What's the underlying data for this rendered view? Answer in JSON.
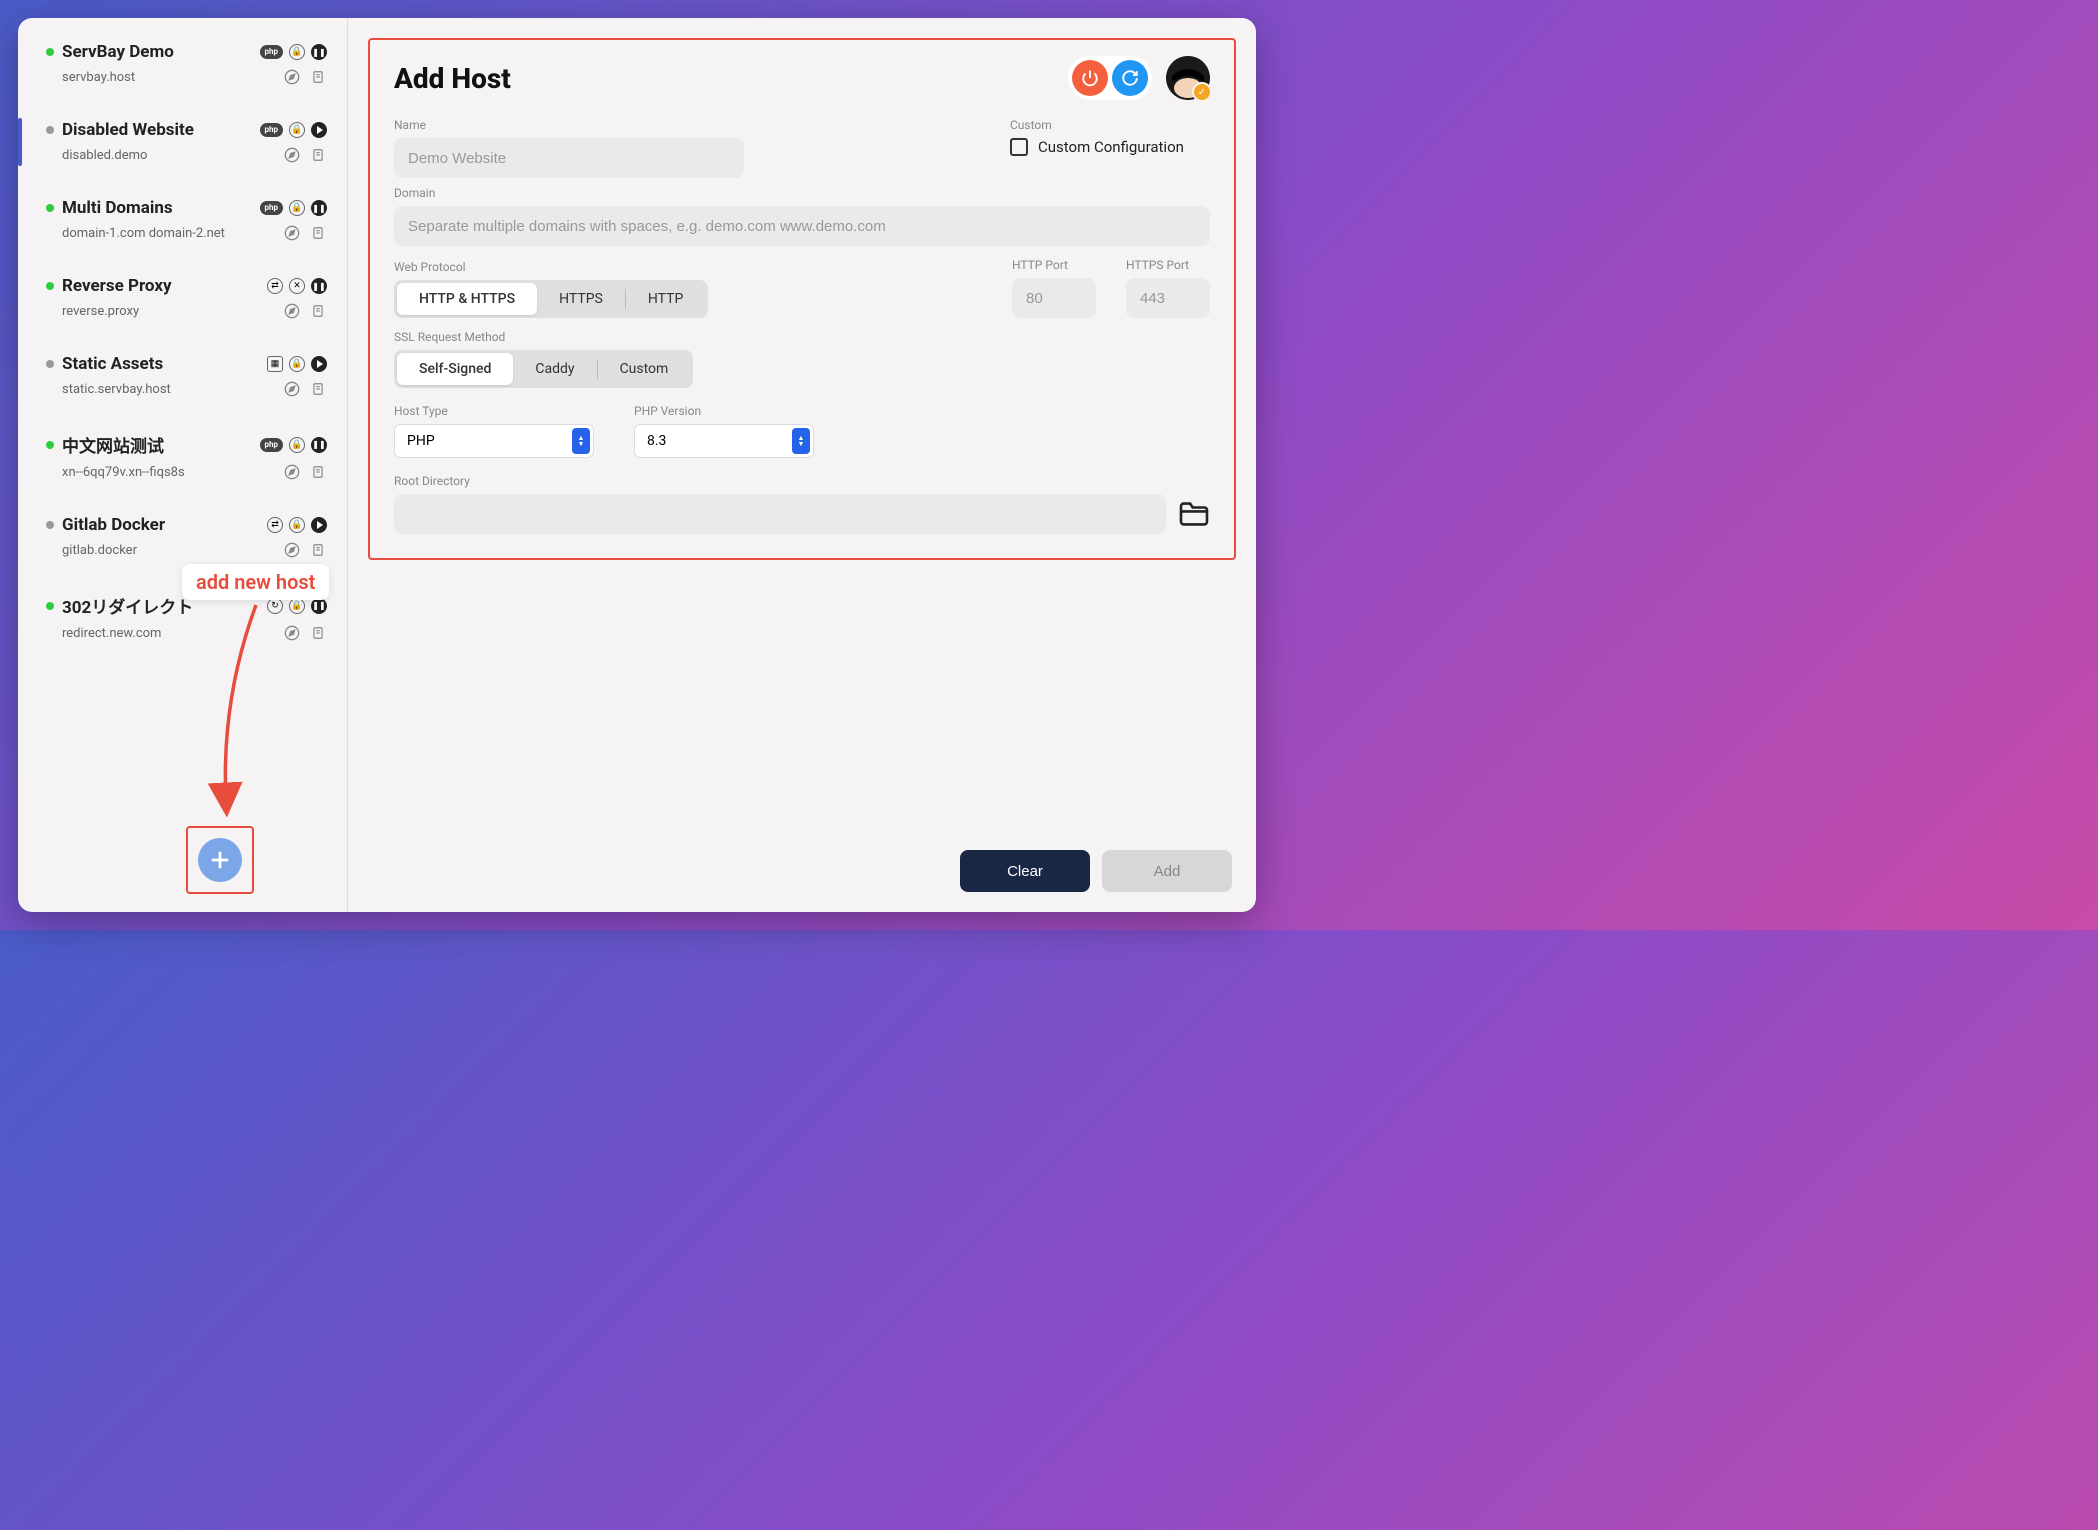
{
  "sidebar": {
    "hosts": [
      {
        "name": "ServBay Demo",
        "domain": "servbay.host",
        "status": "green",
        "badge1": "php",
        "pause": true
      },
      {
        "name": "Disabled Website",
        "domain": "disabled.demo",
        "status": "gray",
        "badge1": "php",
        "play": true,
        "selected": true
      },
      {
        "name": "Multi Domains",
        "domain": "domain-1.com domain-2.net",
        "status": "green",
        "badge1": "php",
        "pause": true
      },
      {
        "name": "Reverse Proxy",
        "domain": "reverse.proxy",
        "status": "green",
        "badge1": "proxy",
        "pause": true,
        "shield_x": true
      },
      {
        "name": "Static Assets",
        "domain": "static.servbay.host",
        "status": "gray",
        "badge1": "static",
        "play": true
      },
      {
        "name": "中文网站测试",
        "domain": "xn--6qq79v.xn--fiqs8s",
        "status": "green",
        "badge1": "php",
        "pause": true
      },
      {
        "name": "Gitlab Docker",
        "domain": "gitlab.docker",
        "status": "gray",
        "badge1": "proxy",
        "play": true
      },
      {
        "name": "302リダイレクト",
        "domain": "redirect.new.com",
        "status": "green",
        "badge1": "redirect",
        "pause": true
      }
    ]
  },
  "main": {
    "title": "Add Host",
    "labels": {
      "name": "Name",
      "custom": "Custom",
      "custom_config": "Custom Configuration",
      "domain": "Domain",
      "web_protocol": "Web Protocol",
      "http_port": "HTTP Port",
      "https_port": "HTTPS Port",
      "ssl_method": "SSL Request Method",
      "host_type": "Host Type",
      "php_version": "PHP Version",
      "root_dir": "Root Directory"
    },
    "placeholders": {
      "name": "Demo Website",
      "domain": "Separate multiple domains with spaces, e.g. demo.com www.demo.com",
      "http_port": "80",
      "https_port": "443"
    },
    "protocol_options": [
      "HTTP & HTTPS",
      "HTTPS",
      "HTTP"
    ],
    "ssl_options": [
      "Self-Signed",
      "Caddy",
      "Custom"
    ],
    "host_type_value": "PHP",
    "php_version_value": "8.3"
  },
  "footer": {
    "clear": "Clear",
    "add": "Add"
  },
  "annotations": {
    "callout": "add new host"
  }
}
